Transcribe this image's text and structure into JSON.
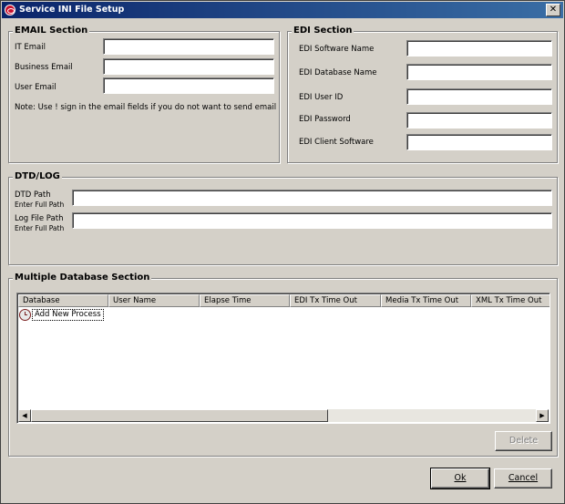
{
  "window": {
    "title": "Service INI File Setup",
    "close_glyph": "✕"
  },
  "email": {
    "legend": "EMAIL Section",
    "it_email_label": "IT Email",
    "business_email_label": "Business Email",
    "user_email_label": "User Email",
    "it_email_value": "",
    "business_email_value": "",
    "user_email_value": "",
    "note": "Note: Use ! sign in the email fields if you do not want to send email"
  },
  "edi": {
    "legend": "EDI Section",
    "software_name_label": "EDI Software Name",
    "database_name_label": "EDI Database Name",
    "user_id_label": "EDI User ID",
    "password_label": "EDI Password",
    "client_software_label": "EDI Client Software",
    "software_name_value": "",
    "database_name_value": "",
    "user_id_value": "",
    "password_value": "",
    "client_software_value": ""
  },
  "dtd": {
    "legend": "DTD/LOG",
    "dtd_path_label": "DTD Path",
    "dtd_path_hint": "Enter Full Path",
    "log_path_label": "Log File Path",
    "log_path_hint": "Enter Full Path",
    "dtd_path_value": "",
    "log_path_value": ""
  },
  "multi_db": {
    "legend": "Multiple Database Section",
    "columns": [
      "Database",
      "User Name",
      "Elapse Time",
      "EDI Tx Time Out",
      "Media Tx Time Out",
      "XML Tx Time Out"
    ],
    "add_row_label": "Add New Process",
    "delete_label": "Delete"
  },
  "footer": {
    "ok_label": "Ok",
    "cancel_label": "Cancel"
  },
  "icons": {
    "app": "oracle-app-icon",
    "add_row": "clock-icon",
    "scroll_left": "arrow-left-icon",
    "scroll_right": "arrow-right-icon"
  }
}
